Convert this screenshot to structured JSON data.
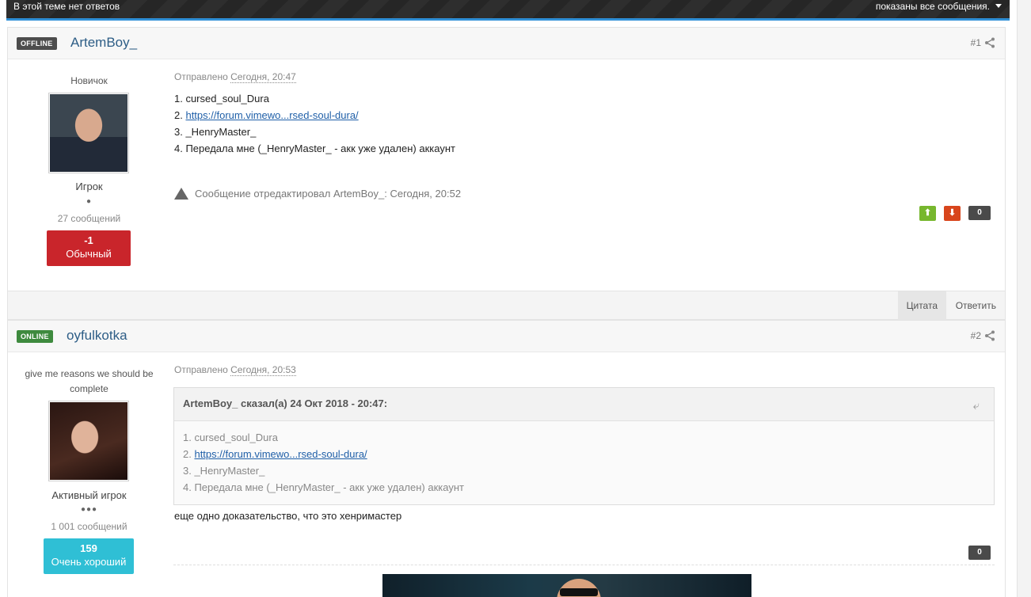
{
  "topbar": {
    "left_text": "В этой теме нет ответов",
    "right_text": "показаны все сообщения."
  },
  "posts": [
    {
      "status": "OFFLINE",
      "username": "ArtemBoy_",
      "number": "#1",
      "rank": "Новичок",
      "group": "Игрок",
      "pips": "●",
      "post_count": "27 сообщений",
      "reputation": {
        "value": "-1",
        "label": "Обычный",
        "color": "#c9252b"
      },
      "posted_prefix": "Отправлено",
      "posted_date": "Сегодня, 20:47",
      "lines": [
        "1. cursed_soul_Dura",
        "2. ",
        "3. _HenryMaster_",
        "4. Передала мне (_HenryMaster_ - акк уже удален) аккаунт"
      ],
      "link": "https://forum.vimewo...rsed-soul-dura/",
      "edit_note": "Сообщение отредактировал ArtemBoy_: Сегодня, 20:52",
      "rep_count": "0",
      "vote_up": "⬆",
      "vote_down": "⬇"
    },
    {
      "status": "ONLINE",
      "username": "oyfulkotka",
      "number": "#2",
      "rank": "give me reasons we should be complete",
      "group": "Активный игрок",
      "pips": "●●●",
      "post_count": "1 001 сообщений",
      "reputation": {
        "value": "159",
        "label": "Очень хороший",
        "color": "#2fbfd5"
      },
      "posted_prefix": "Отправлено",
      "posted_date": "Сегодня, 20:53",
      "quote": {
        "cite": "ArtemBoy_ сказал(а) 24 Окт 2018 - 20:47:",
        "lines": [
          "1. cursed_soul_Dura",
          "2. ",
          "3. _HenryMaster_",
          "4. Передала мне (_HenryMaster_ - акк уже удален) аккаунт"
        ],
        "link": "https://forum.vimewo...rsed-soul-dura/"
      },
      "text": "еще одно доказательство, что это хенримастер",
      "rep_count": "0"
    }
  ],
  "actions": {
    "quote": "Цитата",
    "reply": "Ответить"
  },
  "colors": {
    "accent": "#2f8fd6",
    "link": "#2d5d86"
  }
}
